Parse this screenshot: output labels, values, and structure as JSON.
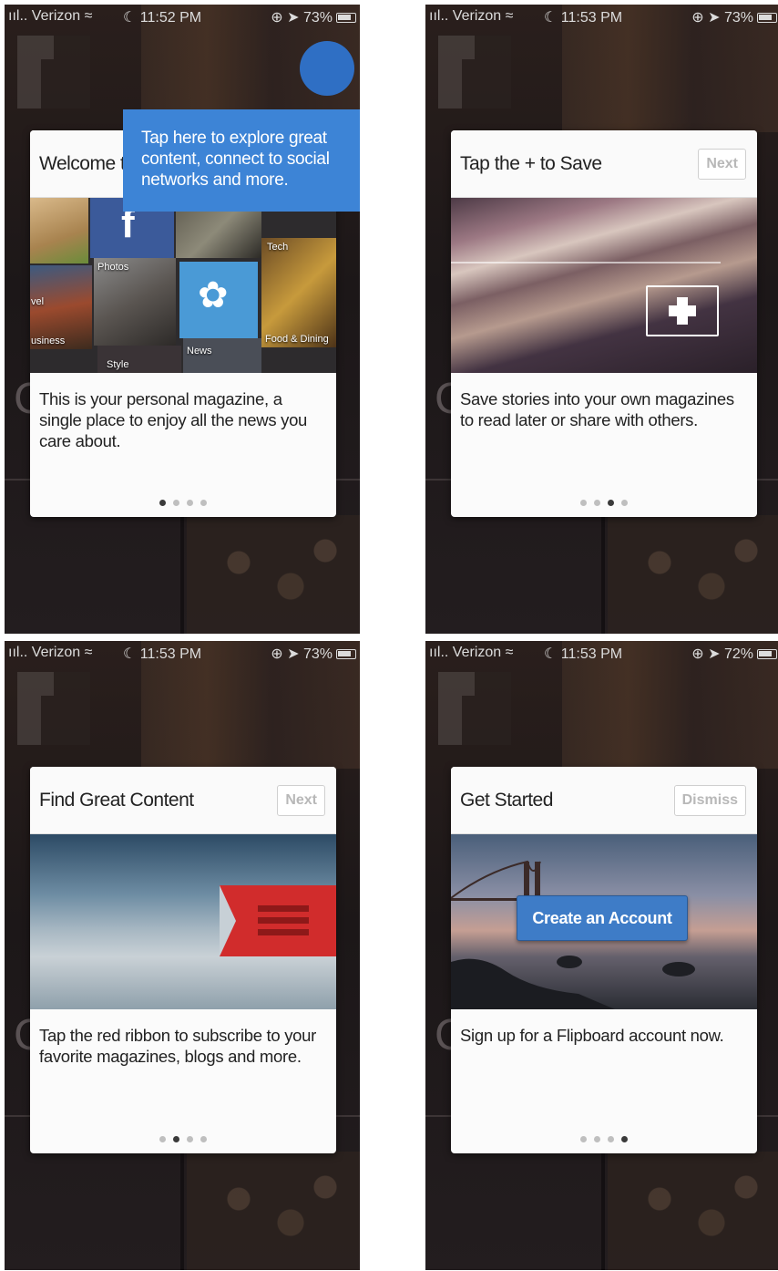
{
  "panels": [
    {
      "status": {
        "carrier": "Verizon",
        "time": "11:52 PM",
        "battery": "73%"
      },
      "card": {
        "title": "Welcome t",
        "body": "This is your personal magazine, a single place to enjoy all the news you care about.",
        "page_index": 0
      },
      "tooltip": "Tap here to explore great content, connect to social networks and more.",
      "tiles": [
        "Photos",
        "Tech",
        "vel",
        "News",
        "Food & Dining",
        "usiness",
        "Style"
      ]
    },
    {
      "status": {
        "carrier": "Verizon",
        "time": "11:53 PM",
        "battery": "73%"
      },
      "card": {
        "title": "Tap the + to Save",
        "button": "Next",
        "body": "Save stories into your own magazines to read later or share with others.",
        "page_index": 2
      }
    },
    {
      "status": {
        "carrier": "Verizon",
        "time": "11:53 PM",
        "battery": "73%"
      },
      "card": {
        "title": "Find Great Content",
        "button": "Next",
        "body": "Tap the red ribbon to subscribe to your favorite magazines, blogs and more.",
        "page_index": 1
      }
    },
    {
      "status": {
        "carrier": "Verizon",
        "time": "11:53 PM",
        "battery": "72%"
      },
      "card": {
        "title": "Get Started",
        "button": "Dismiss",
        "cta": "Create an Account",
        "body": "Sign up for a Flipboard account now.",
        "page_index": 3
      }
    }
  ],
  "colors": {
    "accent_blue": "#3d84d6",
    "ribbon_red": "#d12c2c",
    "card_bg": "#fbfbfb"
  },
  "icons": [
    "signal-icon",
    "wifi-icon",
    "moon-icon",
    "lock-rotation-icon",
    "location-icon",
    "battery-icon",
    "facebook-icon",
    "twitter-icon",
    "plus-icon",
    "ribbon-icon"
  ]
}
